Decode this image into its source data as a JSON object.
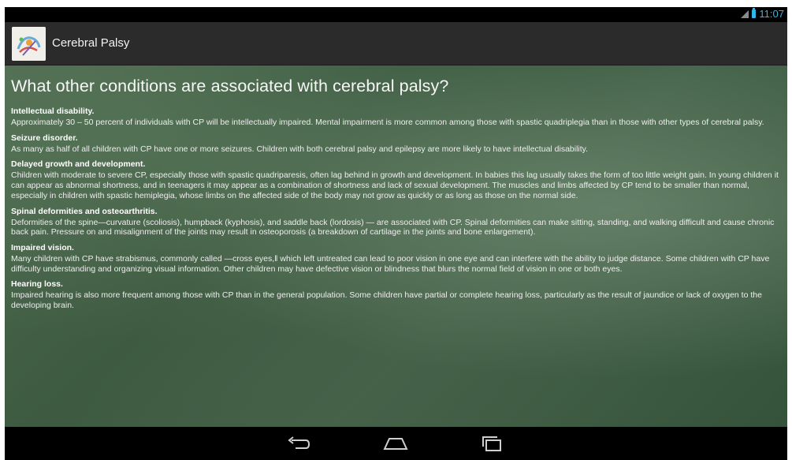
{
  "status_bar": {
    "time": "11:07",
    "icons": [
      "signal-icon",
      "battery-icon"
    ],
    "accent": "#33b5e5"
  },
  "action_bar": {
    "title": "Cerebral Palsy",
    "icon": "app-logo"
  },
  "main": {
    "heading": "What other conditions are associated with cerebral palsy?",
    "sections": [
      {
        "title": "Intellectual disability.",
        "body": "Approximately 30 – 50 percent of individuals with CP will be intellectually impaired. Mental impairment is more common among those with spastic quadriplegia than in those with other types of cerebral palsy."
      },
      {
        "title": "Seizure disorder.",
        "body": "As many as half of all children with CP have one or more seizures. Children with both cerebral palsy and epilepsy are more likely to have intellectual disability."
      },
      {
        "title": "Delayed growth and development.",
        "body": "Children with moderate to severe CP, especially those with spastic quadriparesis, often lag behind in growth and development. In babies this lag usually takes the form of too little weight gain. In young children it can appear as abnormal shortness, and in teenagers it may appear as a combination of shortness and lack of sexual development. The muscles and limbs affected by CP tend to be smaller than normal, especially in children with spastic hemiplegia, whose limbs on the affected side of the body may not grow as quickly or as long as those on the normal side."
      },
      {
        "title": "Spinal deformities and osteoarthritis.",
        "body": "Deformities of the spine—curvature (scoliosis), humpback (kyphosis), and saddle back (lordosis) — are associated with CP. Spinal deformities can make sitting, standing, and walking difficult and cause chronic back pain. Pressure on and misalignment of the joints may result in osteoporosis (a breakdown of cartilage in the joints and bone enlargement)."
      },
      {
        "title": "Impaired vision.",
        "body": "Many children with CP have strabismus, commonly called ―cross eyes,‖ which left untreated can lead to poor vision in one eye and can interfere with the ability to judge distance. Some children with CP have difficulty understanding and organizing visual information. Other children may have defective vision or blindness that blurs the normal field of vision in one or both eyes."
      },
      {
        "title": "Hearing loss.",
        "body": "Impaired hearing is also more frequent among those with CP than in the general population. Some children have partial or complete hearing loss, particularly as the result of jaundice or lack of oxygen to the developing brain."
      }
    ]
  },
  "nav_bar": {
    "buttons": [
      "back-icon",
      "home-icon",
      "recents-icon"
    ]
  }
}
